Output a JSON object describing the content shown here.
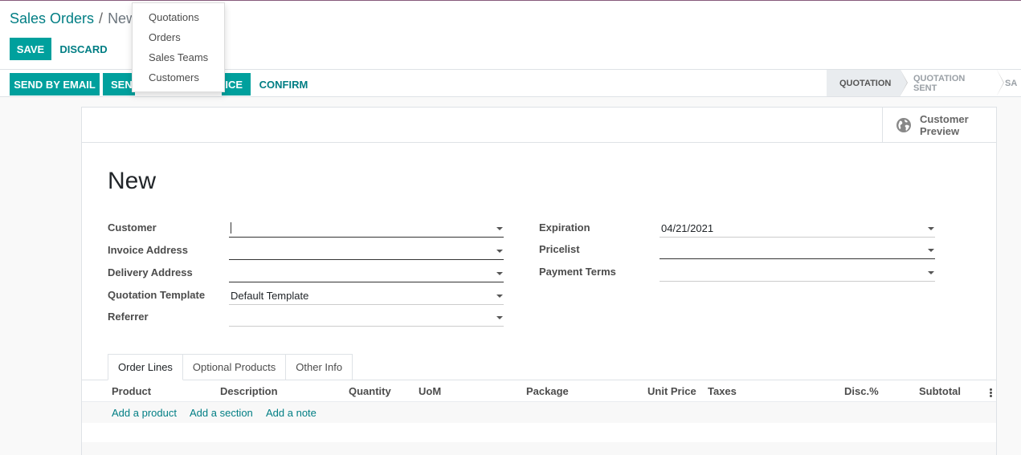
{
  "breadcrumb": {
    "root": "Sales Orders",
    "separator": "/",
    "current": "New"
  },
  "buttons": {
    "save": "SAVE",
    "discard": "DISCARD",
    "send_by_email": "SEND BY EMAIL",
    "send_proforma_partial": "SEN",
    "invoice_partial": "ICE",
    "confirm": "CONFIRM"
  },
  "dropdown_menu": {
    "items": [
      "Quotations",
      "Orders",
      "Sales Teams",
      "Customers"
    ]
  },
  "statusbar": {
    "stages": [
      "QUOTATION",
      "QUOTATION SENT",
      "SA"
    ],
    "active": "QUOTATION"
  },
  "smart_button": {
    "label_line1": "Customer",
    "label_line2": "Preview",
    "icon": "globe-icon"
  },
  "record": {
    "title": "New"
  },
  "form": {
    "left": [
      {
        "label": "Customer",
        "value": ""
      },
      {
        "label": "Invoice Address",
        "value": ""
      },
      {
        "label": "Delivery Address",
        "value": ""
      },
      {
        "label": "Quotation Template",
        "value": "Default Template"
      },
      {
        "label": "Referrer",
        "value": ""
      }
    ],
    "right": [
      {
        "label": "Expiration",
        "value": "04/21/2021"
      },
      {
        "label": "Pricelist",
        "value": ""
      },
      {
        "label": "Payment Terms",
        "value": ""
      }
    ]
  },
  "tabs": [
    "Order Lines",
    "Optional Products",
    "Other Info"
  ],
  "order_lines": {
    "columns": [
      "Product",
      "Description",
      "Quantity",
      "UoM",
      "Package",
      "Unit Price",
      "Taxes",
      "Disc.%",
      "Subtotal"
    ],
    "actions": [
      "Add a product",
      "Add a section",
      "Add a note"
    ]
  },
  "colors": {
    "accent": "#00a09d",
    "link": "#017e84",
    "brand_top": "#875a7b"
  }
}
